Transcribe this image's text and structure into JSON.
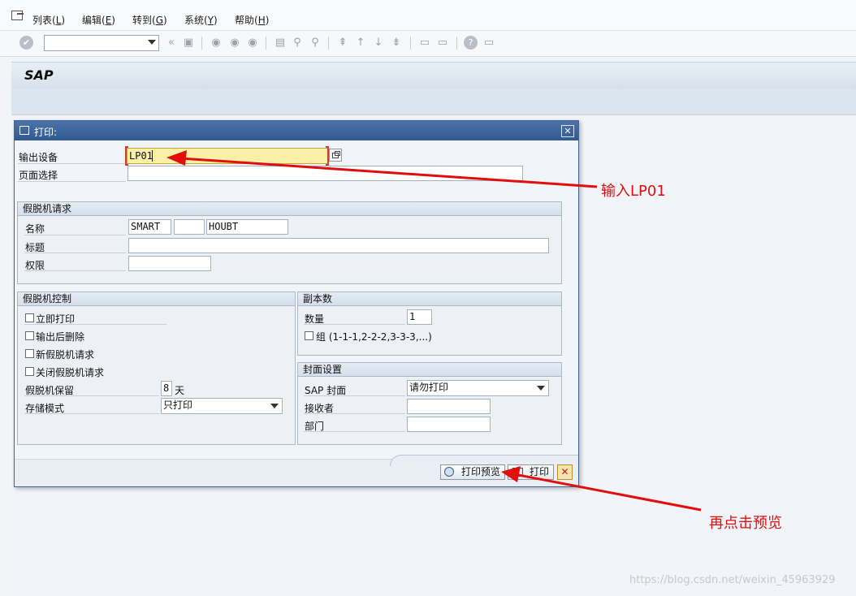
{
  "menubar": {
    "items": [
      {
        "label": "列表(",
        "key": "L",
        "end": ")"
      },
      {
        "label": "编辑(",
        "key": "E",
        "end": ")"
      },
      {
        "label": "转到(",
        "key": "G",
        "end": ")"
      },
      {
        "label": "系统(",
        "key": "Y",
        "end": ")"
      },
      {
        "label": "帮助(",
        "key": "H",
        "end": ")"
      }
    ]
  },
  "toolbar": {
    "command_value": ""
  },
  "app": {
    "title": "SAP"
  },
  "dialog": {
    "title": "打印:",
    "output_device_label": "输出设备",
    "output_device_value": "LP01",
    "page_selection_label": "页面选择",
    "page_selection_value": "",
    "spool_request": {
      "heading": "假脱机请求",
      "name_label": "名称",
      "name_part1": "SMART",
      "name_part2": "",
      "name_part3": "HOUBT",
      "title_label": "标题",
      "title_value": "",
      "auth_label": "权限",
      "auth_value": ""
    },
    "spool_control": {
      "heading": "假脱机控制",
      "print_immediately": "立即打印",
      "delete_after_output": "输出后删除",
      "new_spool_request": "新假脱机请求",
      "close_spool_request": "关闭假脱机请求",
      "retention_label": "假脱机保留",
      "retention_value": "8",
      "retention_unit": "天",
      "storage_mode_label": "存储模式",
      "storage_mode_value": "只打印"
    },
    "copies": {
      "heading": "副本数",
      "quantity_label": "数量",
      "quantity_value": "1",
      "group_label": "组 (1-1-1,2-2-2,3-3-3,...)"
    },
    "cover_page": {
      "heading": "封面设置",
      "sap_cover_label": "SAP 封面",
      "sap_cover_value": "请勿打印",
      "recipient_label": "接收者",
      "recipient_value": "",
      "department_label": "部门",
      "department_value": ""
    },
    "buttons": {
      "print_preview": "打印预览",
      "print": "打印"
    }
  },
  "annotations": {
    "first": "输入LP01",
    "second": "再点击预览"
  },
  "watermark": "https://blog.csdn.net/weixin_45963929",
  "colors": {
    "annotation_red": "#e20d0d",
    "title_blue": "#3a6399",
    "focus_yellow": "#fbf0a8"
  }
}
